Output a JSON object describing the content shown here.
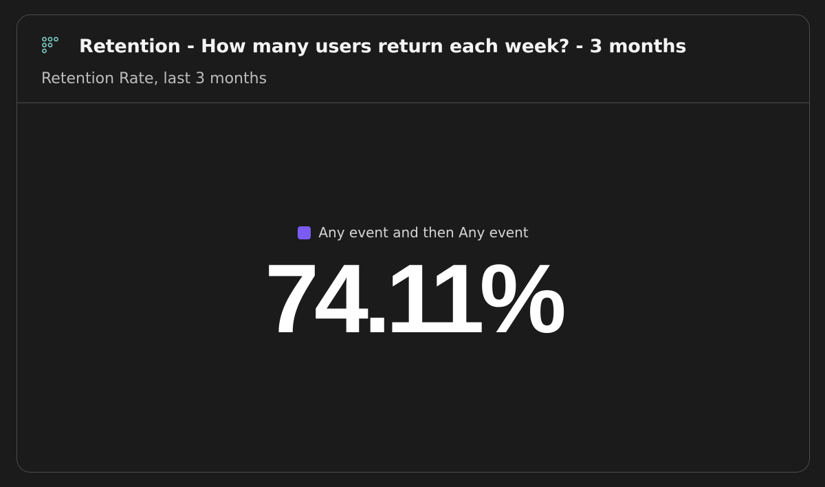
{
  "card": {
    "icon": "retention-grid-icon",
    "title": "Retention - How many users return each week? - 3 months",
    "subtitle": "Retention Rate, last 3 months"
  },
  "metric": {
    "legend_label": "Any event and then Any event",
    "legend_color": "#7a5cf5",
    "value": "74.11%"
  },
  "colors": {
    "background": "#1b1b1b",
    "border": "#4b4b4b",
    "icon": "#7ed1c9",
    "text": "#f4f4f4",
    "muted_text": "#bdbdbd"
  }
}
